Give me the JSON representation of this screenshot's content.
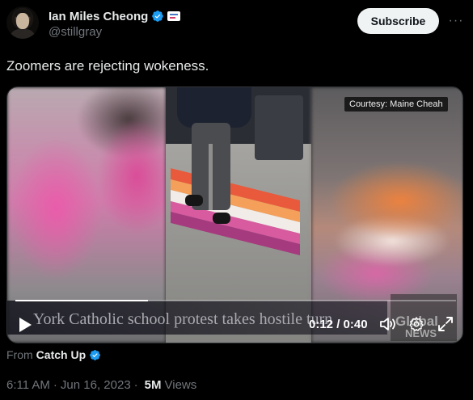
{
  "author": {
    "name": "Ian Miles Cheong",
    "handle": "@stillgray",
    "verified": true
  },
  "actions": {
    "subscribe_label": "Subscribe",
    "more_label": "···"
  },
  "tweet": {
    "text": "Zoomers are rejecting wokeness."
  },
  "video": {
    "courtesy": "Courtesy: Maine Cheah",
    "headline": "York Catholic school protest takes hostile turn",
    "watermark_main": "Global",
    "watermark_sub": "NEWS",
    "elapsed": "0:12",
    "duration": "0:40",
    "progress": 0.3,
    "time_label": "0:12 / 0:40"
  },
  "source": {
    "from_label": "From",
    "name": "Catch Up",
    "verified": true
  },
  "meta": {
    "time": "6:11 AM",
    "date": "Jun 16, 2023",
    "views_count": "5M",
    "views_label": "Views"
  },
  "colors": {
    "verified_blue": "#1d9bf0",
    "background": "#000000",
    "text_primary": "#e7e9ea",
    "text_secondary": "#71767b"
  }
}
